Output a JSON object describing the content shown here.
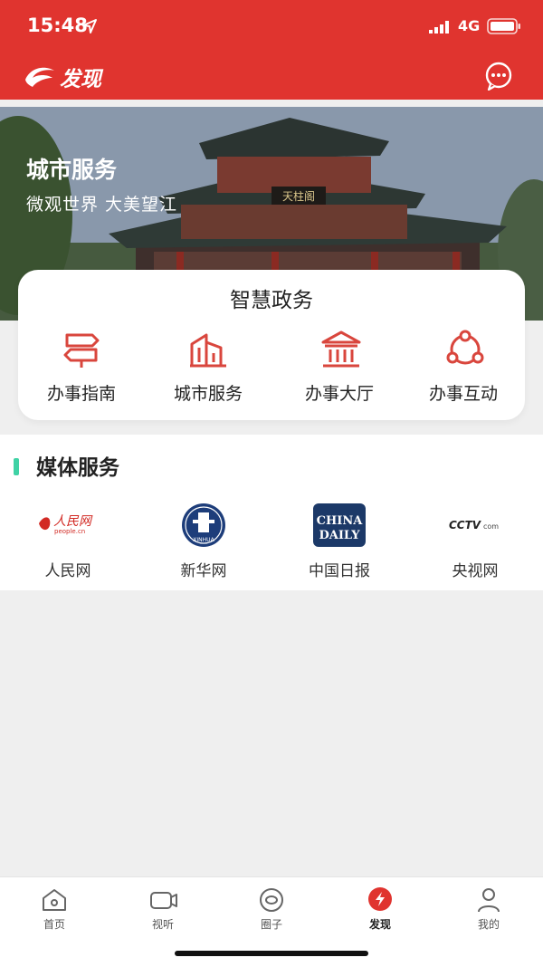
{
  "status_bar": {
    "time": "15:48",
    "network": "4G"
  },
  "header": {
    "title": "发现"
  },
  "banner": {
    "title": "城市服务",
    "subtitle": "微观世界  大美望江",
    "sign": "天柱阁"
  },
  "gov_card": {
    "title": "智慧政务",
    "items": [
      {
        "label": "办事指南",
        "icon": "signpost-icon"
      },
      {
        "label": "城市服务",
        "icon": "building-icon"
      },
      {
        "label": "办事大厅",
        "icon": "hall-icon"
      },
      {
        "label": "办事互动",
        "icon": "interaction-icon"
      }
    ]
  },
  "media_section": {
    "title": "媒体服务",
    "items": [
      {
        "label": "人民网",
        "logo_text": "人民网",
        "logo_sub": "people.cn"
      },
      {
        "label": "新华网",
        "logo_text": "XINHUA"
      },
      {
        "label": "中国日报",
        "logo_text": "CHINA",
        "logo_text2": "DAILY"
      },
      {
        "label": "央视网",
        "logo_text": "CCTV",
        "logo_sub": "com"
      }
    ]
  },
  "tab_bar": {
    "tabs": [
      {
        "label": "首页",
        "icon": "home-icon"
      },
      {
        "label": "视听",
        "icon": "video-icon"
      },
      {
        "label": "圈子",
        "icon": "circle-icon"
      },
      {
        "label": "发现",
        "icon": "discover-icon",
        "active": true
      },
      {
        "label": "我的",
        "icon": "profile-icon"
      }
    ]
  },
  "colors": {
    "brand_red": "#e0342f",
    "icon_red": "#d9463d",
    "section_accent": "#3fd2a5"
  }
}
